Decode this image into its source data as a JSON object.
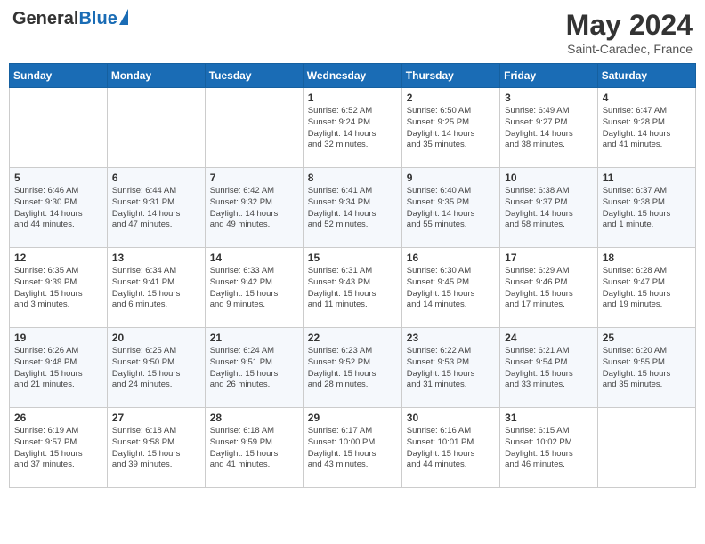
{
  "header": {
    "logo_general": "General",
    "logo_blue": "Blue",
    "month": "May 2024",
    "location": "Saint-Caradec, France"
  },
  "days_of_week": [
    "Sunday",
    "Monday",
    "Tuesday",
    "Wednesday",
    "Thursday",
    "Friday",
    "Saturday"
  ],
  "weeks": [
    [
      {
        "day": "",
        "info": ""
      },
      {
        "day": "",
        "info": ""
      },
      {
        "day": "",
        "info": ""
      },
      {
        "day": "1",
        "info": "Sunrise: 6:52 AM\nSunset: 9:24 PM\nDaylight: 14 hours\nand 32 minutes."
      },
      {
        "day": "2",
        "info": "Sunrise: 6:50 AM\nSunset: 9:25 PM\nDaylight: 14 hours\nand 35 minutes."
      },
      {
        "day": "3",
        "info": "Sunrise: 6:49 AM\nSunset: 9:27 PM\nDaylight: 14 hours\nand 38 minutes."
      },
      {
        "day": "4",
        "info": "Sunrise: 6:47 AM\nSunset: 9:28 PM\nDaylight: 14 hours\nand 41 minutes."
      }
    ],
    [
      {
        "day": "5",
        "info": "Sunrise: 6:46 AM\nSunset: 9:30 PM\nDaylight: 14 hours\nand 44 minutes."
      },
      {
        "day": "6",
        "info": "Sunrise: 6:44 AM\nSunset: 9:31 PM\nDaylight: 14 hours\nand 47 minutes."
      },
      {
        "day": "7",
        "info": "Sunrise: 6:42 AM\nSunset: 9:32 PM\nDaylight: 14 hours\nand 49 minutes."
      },
      {
        "day": "8",
        "info": "Sunrise: 6:41 AM\nSunset: 9:34 PM\nDaylight: 14 hours\nand 52 minutes."
      },
      {
        "day": "9",
        "info": "Sunrise: 6:40 AM\nSunset: 9:35 PM\nDaylight: 14 hours\nand 55 minutes."
      },
      {
        "day": "10",
        "info": "Sunrise: 6:38 AM\nSunset: 9:37 PM\nDaylight: 14 hours\nand 58 minutes."
      },
      {
        "day": "11",
        "info": "Sunrise: 6:37 AM\nSunset: 9:38 PM\nDaylight: 15 hours\nand 1 minute."
      }
    ],
    [
      {
        "day": "12",
        "info": "Sunrise: 6:35 AM\nSunset: 9:39 PM\nDaylight: 15 hours\nand 3 minutes."
      },
      {
        "day": "13",
        "info": "Sunrise: 6:34 AM\nSunset: 9:41 PM\nDaylight: 15 hours\nand 6 minutes."
      },
      {
        "day": "14",
        "info": "Sunrise: 6:33 AM\nSunset: 9:42 PM\nDaylight: 15 hours\nand 9 minutes."
      },
      {
        "day": "15",
        "info": "Sunrise: 6:31 AM\nSunset: 9:43 PM\nDaylight: 15 hours\nand 11 minutes."
      },
      {
        "day": "16",
        "info": "Sunrise: 6:30 AM\nSunset: 9:45 PM\nDaylight: 15 hours\nand 14 minutes."
      },
      {
        "day": "17",
        "info": "Sunrise: 6:29 AM\nSunset: 9:46 PM\nDaylight: 15 hours\nand 17 minutes."
      },
      {
        "day": "18",
        "info": "Sunrise: 6:28 AM\nSunset: 9:47 PM\nDaylight: 15 hours\nand 19 minutes."
      }
    ],
    [
      {
        "day": "19",
        "info": "Sunrise: 6:26 AM\nSunset: 9:48 PM\nDaylight: 15 hours\nand 21 minutes."
      },
      {
        "day": "20",
        "info": "Sunrise: 6:25 AM\nSunset: 9:50 PM\nDaylight: 15 hours\nand 24 minutes."
      },
      {
        "day": "21",
        "info": "Sunrise: 6:24 AM\nSunset: 9:51 PM\nDaylight: 15 hours\nand 26 minutes."
      },
      {
        "day": "22",
        "info": "Sunrise: 6:23 AM\nSunset: 9:52 PM\nDaylight: 15 hours\nand 28 minutes."
      },
      {
        "day": "23",
        "info": "Sunrise: 6:22 AM\nSunset: 9:53 PM\nDaylight: 15 hours\nand 31 minutes."
      },
      {
        "day": "24",
        "info": "Sunrise: 6:21 AM\nSunset: 9:54 PM\nDaylight: 15 hours\nand 33 minutes."
      },
      {
        "day": "25",
        "info": "Sunrise: 6:20 AM\nSunset: 9:55 PM\nDaylight: 15 hours\nand 35 minutes."
      }
    ],
    [
      {
        "day": "26",
        "info": "Sunrise: 6:19 AM\nSunset: 9:57 PM\nDaylight: 15 hours\nand 37 minutes."
      },
      {
        "day": "27",
        "info": "Sunrise: 6:18 AM\nSunset: 9:58 PM\nDaylight: 15 hours\nand 39 minutes."
      },
      {
        "day": "28",
        "info": "Sunrise: 6:18 AM\nSunset: 9:59 PM\nDaylight: 15 hours\nand 41 minutes."
      },
      {
        "day": "29",
        "info": "Sunrise: 6:17 AM\nSunset: 10:00 PM\nDaylight: 15 hours\nand 43 minutes."
      },
      {
        "day": "30",
        "info": "Sunrise: 6:16 AM\nSunset: 10:01 PM\nDaylight: 15 hours\nand 44 minutes."
      },
      {
        "day": "31",
        "info": "Sunrise: 6:15 AM\nSunset: 10:02 PM\nDaylight: 15 hours\nand 46 minutes."
      },
      {
        "day": "",
        "info": ""
      }
    ]
  ]
}
